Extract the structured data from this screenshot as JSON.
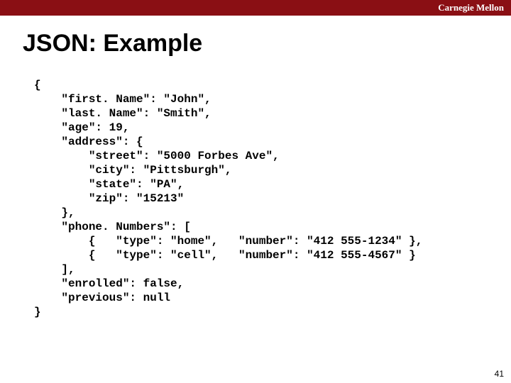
{
  "brand": "Carnegie Mellon",
  "title": "JSON: Example",
  "code_lines": [
    "{",
    "    \"first. Name\": \"John\",",
    "    \"last. Name\": \"Smith\",",
    "    \"age\": 19,",
    "    \"address\": {",
    "        \"street\": \"5000 Forbes Ave\",",
    "        \"city\": \"Pittsburgh\",",
    "        \"state\": \"PA\",",
    "        \"zip\": \"15213\"",
    "    },",
    "    \"phone. Numbers\": [",
    "        {   \"type\": \"home\",   \"number\": \"412 555-1234\" },",
    "        {   \"type\": \"cell\",   \"number\": \"412 555-4567\" }",
    "    ],",
    "    \"enrolled\": false,",
    "    \"previous\": null",
    "}"
  ],
  "page_number": "41"
}
